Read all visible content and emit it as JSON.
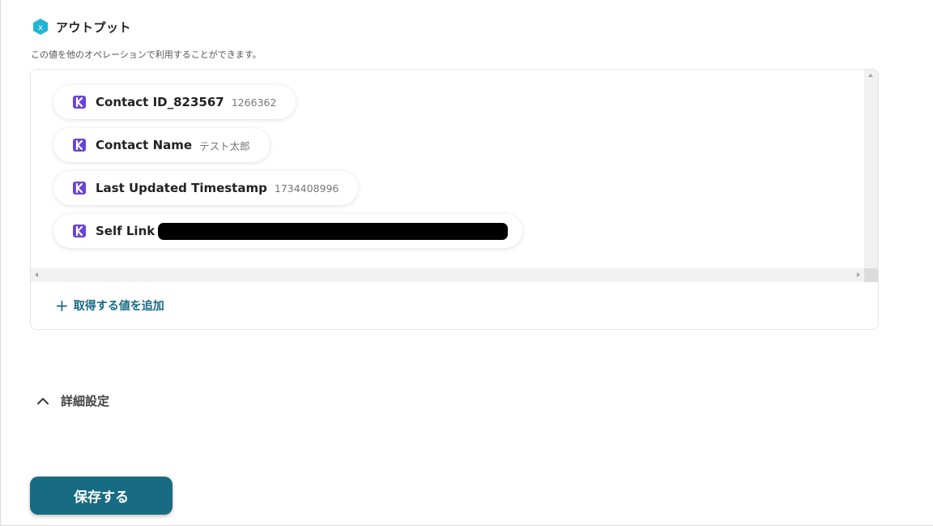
{
  "section": {
    "title": "アウトプット",
    "description": "この値を他のオペレーションで利用することができます。"
  },
  "outputs": [
    {
      "label": "Contact ID_823567",
      "value": "1266362",
      "icon": "app-k-icon"
    },
    {
      "label": "Contact Name",
      "value": "テスト太郎",
      "icon": "app-k-icon"
    },
    {
      "label": "Last Updated Timestamp",
      "value": "1734408996",
      "icon": "app-k-icon"
    },
    {
      "label": "Self Link",
      "value": null,
      "redacted": true,
      "icon": "app-k-icon"
    }
  ],
  "add_value": {
    "label": "取得する値を追加",
    "icon": "plus-icon"
  },
  "advanced": {
    "label": "詳細設定",
    "icon": "chevron-up-icon"
  },
  "save_button": {
    "label": "保存する"
  },
  "colors": {
    "accent": "#176b82",
    "app_icon": "#6a44d6",
    "section_icon": "#1fb5d6"
  }
}
